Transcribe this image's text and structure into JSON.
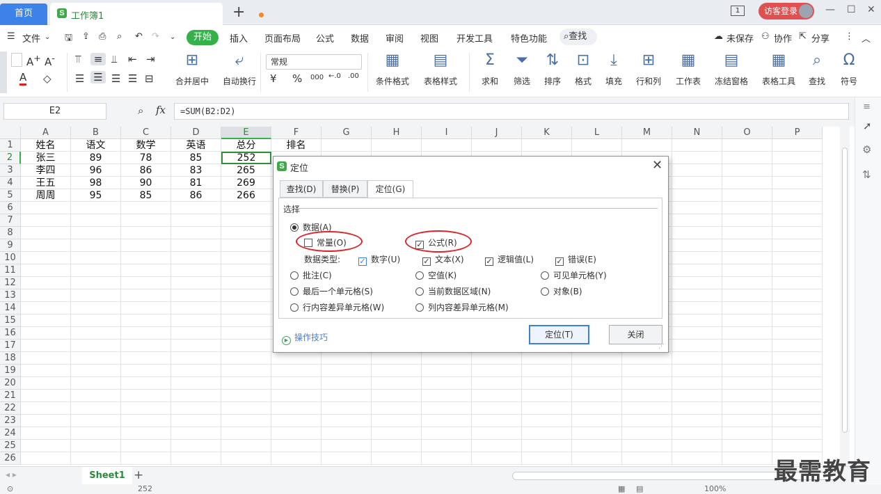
{
  "tabs": {
    "home": "首页",
    "document": "工作簿1",
    "window_count": "1"
  },
  "account": {
    "login": "访客登录"
  },
  "menu": {
    "file": "文件",
    "items": [
      "开始",
      "插入",
      "页面布局",
      "公式",
      "数据",
      "审阅",
      "视图",
      "开发工具",
      "特色功能"
    ],
    "search": "查找",
    "unsaved": "未保存",
    "collab": "协作",
    "share": "分享"
  },
  "ribbon": {
    "merge": "合并居中",
    "wrap": "自动换行",
    "number_format": "常规",
    "cond_format": "条件格式",
    "table_style": "表格样式",
    "sum": "求和",
    "filter": "筛选",
    "sort": "排序",
    "format": "格式",
    "fill": "填充",
    "rowcol": "行和列",
    "worksheet": "工作表",
    "freeze": "冻结窗格",
    "table_tools": "表格工具",
    "find": "查找",
    "symbol": "符号"
  },
  "formula_bar": {
    "name_box": "E2",
    "fx": "fx",
    "formula": "=SUM(B2:D2)"
  },
  "sheet": {
    "columns": [
      "A",
      "B",
      "C",
      "D",
      "E",
      "F",
      "G",
      "H",
      "I",
      "J",
      "K",
      "L",
      "M",
      "N",
      "O",
      "P"
    ],
    "row_numbers": [
      "1",
      "2",
      "3",
      "4",
      "5",
      "6",
      "7",
      "8",
      "9",
      "10",
      "11",
      "12",
      "13",
      "14",
      "15",
      "16",
      "17",
      "18",
      "19",
      "20",
      "21",
      "22",
      "23",
      "24",
      "25",
      "26"
    ],
    "rows": [
      [
        "姓名",
        "语文",
        "数学",
        "英语",
        "总分",
        "排名"
      ],
      [
        "张三",
        "89",
        "78",
        "85",
        "252",
        ""
      ],
      [
        "李四",
        "96",
        "86",
        "83",
        "265",
        ""
      ],
      [
        "王五",
        "98",
        "90",
        "81",
        "269",
        ""
      ],
      [
        "周周",
        "95",
        "85",
        "86",
        "266",
        ""
      ]
    ],
    "active_cell": "E2",
    "sheet_tab": "Sheet1",
    "status_value": "252",
    "zoom": "100%"
  },
  "dialog": {
    "title": "定位",
    "tabs": [
      "查找(D)",
      "替换(P)",
      "定位(G)"
    ],
    "group_label": "选择",
    "data_option": "数据(A)",
    "constants": "常量(O)",
    "formulas": "公式(R)",
    "data_type_label": "数据类型:",
    "types": [
      "数字(U)",
      "文本(X)",
      "逻辑值(L)",
      "错误(E)"
    ],
    "options": [
      "批注(C)",
      "空值(K)",
      "可见单元格(Y)",
      "最后一个单元格(S)",
      "当前数据区域(N)",
      "对象(B)",
      "行内容差异单元格(W)",
      "列内容差异单元格(M)"
    ],
    "tips": "操作技巧",
    "ok": "定位(T)",
    "close": "关闭"
  },
  "watermark": "最需教育"
}
